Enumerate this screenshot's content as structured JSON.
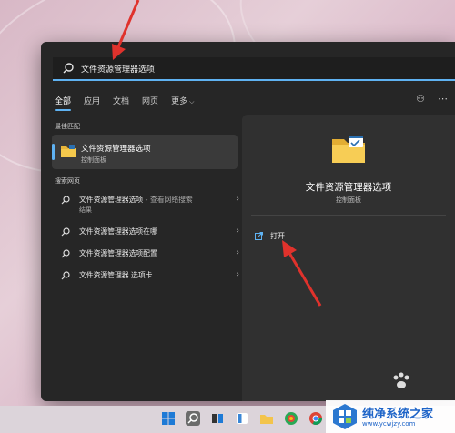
{
  "search": {
    "value": "文件资源管理器选项"
  },
  "tabs": [
    {
      "label": "全部"
    },
    {
      "label": "应用"
    },
    {
      "label": "文档"
    },
    {
      "label": "网页"
    },
    {
      "label": "更多"
    }
  ],
  "best_match": {
    "section_label": "最佳匹配",
    "title": "文件资源管理器选项",
    "subtitle": "控制面板"
  },
  "web_search": {
    "section_label": "搜索网页",
    "items": [
      {
        "text": "文件资源管理器选项",
        "suffix": " - 查看网络搜索",
        "sub": "结果"
      },
      {
        "text": "文件资源管理器选项在哪"
      },
      {
        "text": "文件资源管理器选项配置"
      },
      {
        "text": "文件资源管理器 选项卡"
      }
    ]
  },
  "detail": {
    "title": "文件资源管理器选项",
    "subtitle": "控制面板",
    "open_label": "打开"
  },
  "watermark": {
    "title": "纯净系统之家",
    "url": "www.ycwjzy.com"
  },
  "colors": {
    "accent": "#5fb2f2",
    "annotation": "#e0322c",
    "panel": "#262626"
  }
}
